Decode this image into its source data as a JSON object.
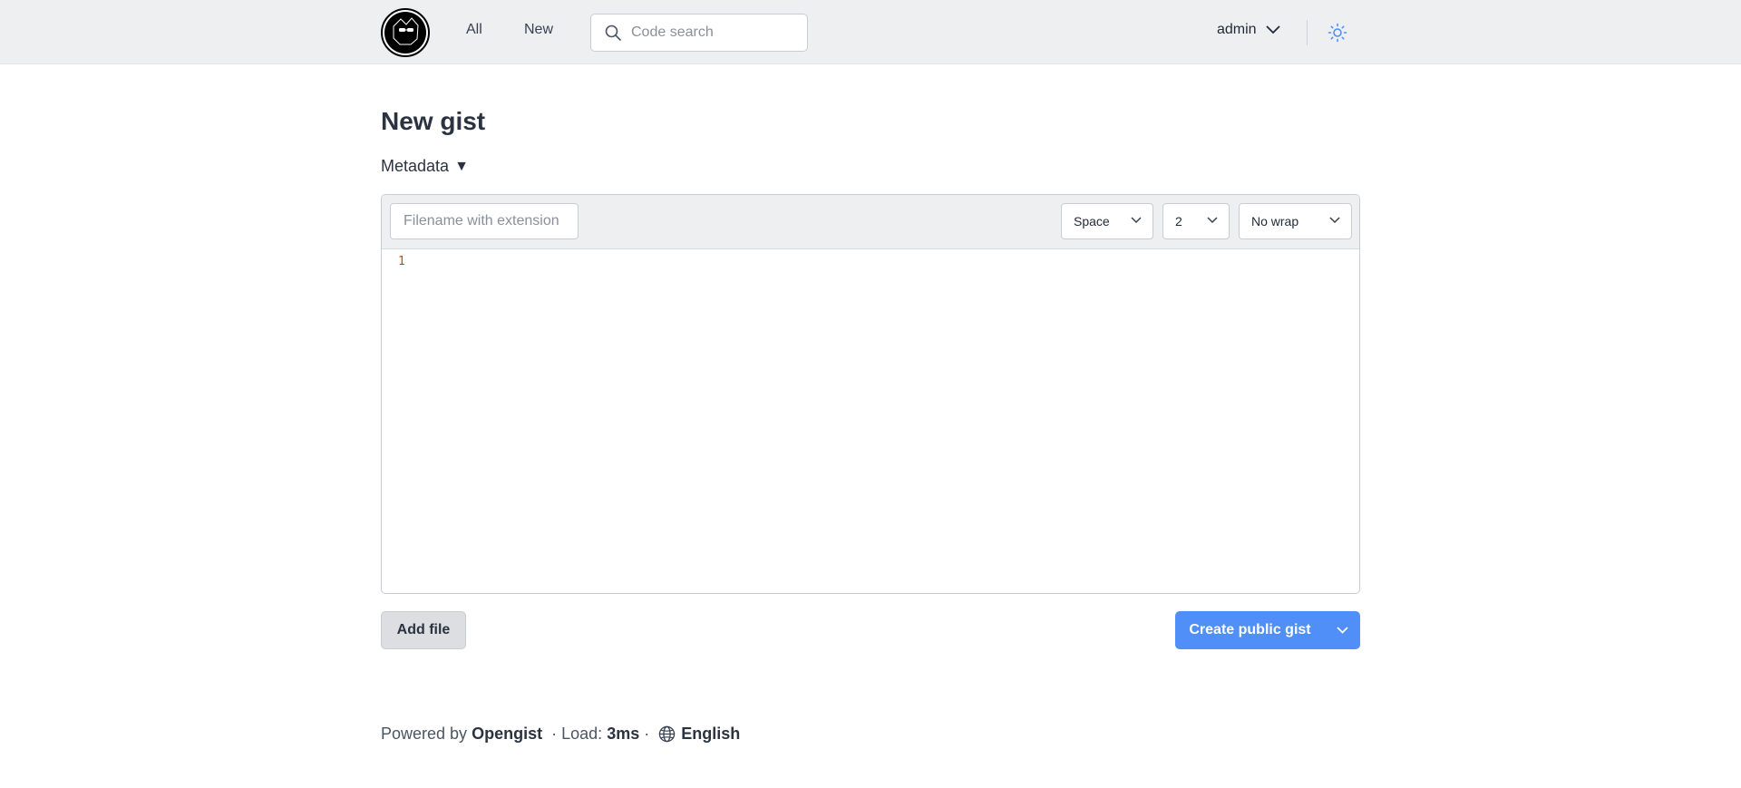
{
  "header": {
    "nav": {
      "all": "All",
      "new": "New"
    },
    "search_placeholder": "Code search",
    "user": "admin"
  },
  "main": {
    "title": "New gist",
    "metadata_label": "Metadata",
    "metadata_arrow": "▼",
    "editor": {
      "filename_placeholder": "Filename with extension",
      "indent_style": "Space",
      "indent_size": "2",
      "wrap": "No wrap",
      "line_numbers": [
        "1"
      ]
    },
    "add_file": "Add file",
    "create": "Create public gist"
  },
  "footer": {
    "powered_by": "Powered by",
    "brand": "Opengist",
    "load_label": "Load:",
    "load_value": "3ms",
    "separator": "·",
    "language": "English"
  },
  "colors": {
    "accent": "#4f8ff7",
    "header_bg": "#eeeff1",
    "line_number": "#b45309"
  },
  "icons": [
    "opengist-logo",
    "search-icon",
    "chevron-down-icon",
    "sun-icon",
    "globe-icon"
  ]
}
